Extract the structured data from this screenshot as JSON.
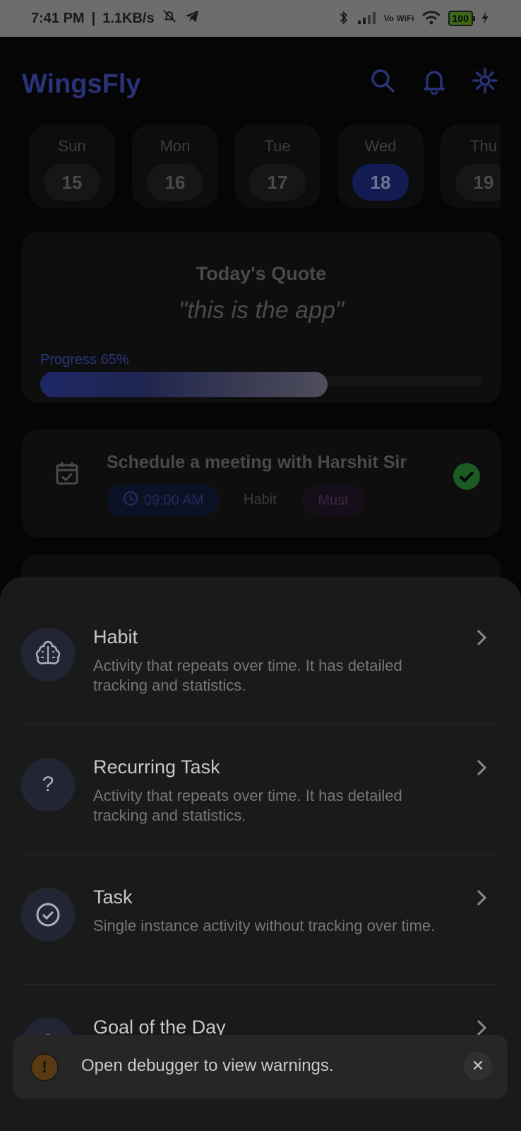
{
  "status_bar": {
    "time": "7:41 PM",
    "speed": "1.1KB/s",
    "vowifi": "Vo WiFi",
    "battery": "100"
  },
  "header": {
    "title": "WingsFly",
    "icons": [
      "search-icon",
      "bell-icon",
      "gear-icon"
    ]
  },
  "days": [
    {
      "name": "Sun",
      "num": "15"
    },
    {
      "name": "Mon",
      "num": "16"
    },
    {
      "name": "Tue",
      "num": "17"
    },
    {
      "name": "Wed",
      "num": "18",
      "active": true
    },
    {
      "name": "Thu",
      "num": "19"
    }
  ],
  "quote": {
    "title": "Today's Quote",
    "text": "\"this is the app\"",
    "progress_label": "Progress 65%",
    "progress": 0.65
  },
  "task": {
    "title": "Schedule a meeting with Harshit Sir",
    "time": "09:00 AM",
    "category": "Habit",
    "priority": "Must",
    "completed": true
  },
  "sheet": {
    "options": [
      {
        "title": "Habit",
        "desc": "Activity that repeats over time. It has detailed tracking and statistics.",
        "icon": "brain-icon"
      },
      {
        "title": "Recurring Task",
        "desc": "Activity that repeats over time. It has detailed tracking and statistics.",
        "icon": "question-icon"
      },
      {
        "title": "Task",
        "desc": "Single instance activity without tracking over time.",
        "icon": "check-circle-icon"
      },
      {
        "title": "Goal of the Day",
        "desc": "",
        "icon": "goal-icon"
      }
    ]
  },
  "toast": {
    "text": "Open debugger to view warnings.",
    "icon": "!",
    "close": "✕"
  },
  "colors": {
    "accent": "#2a3278",
    "sheet_bg": "#1a1a1a",
    "check_green": "#1c5a24"
  }
}
